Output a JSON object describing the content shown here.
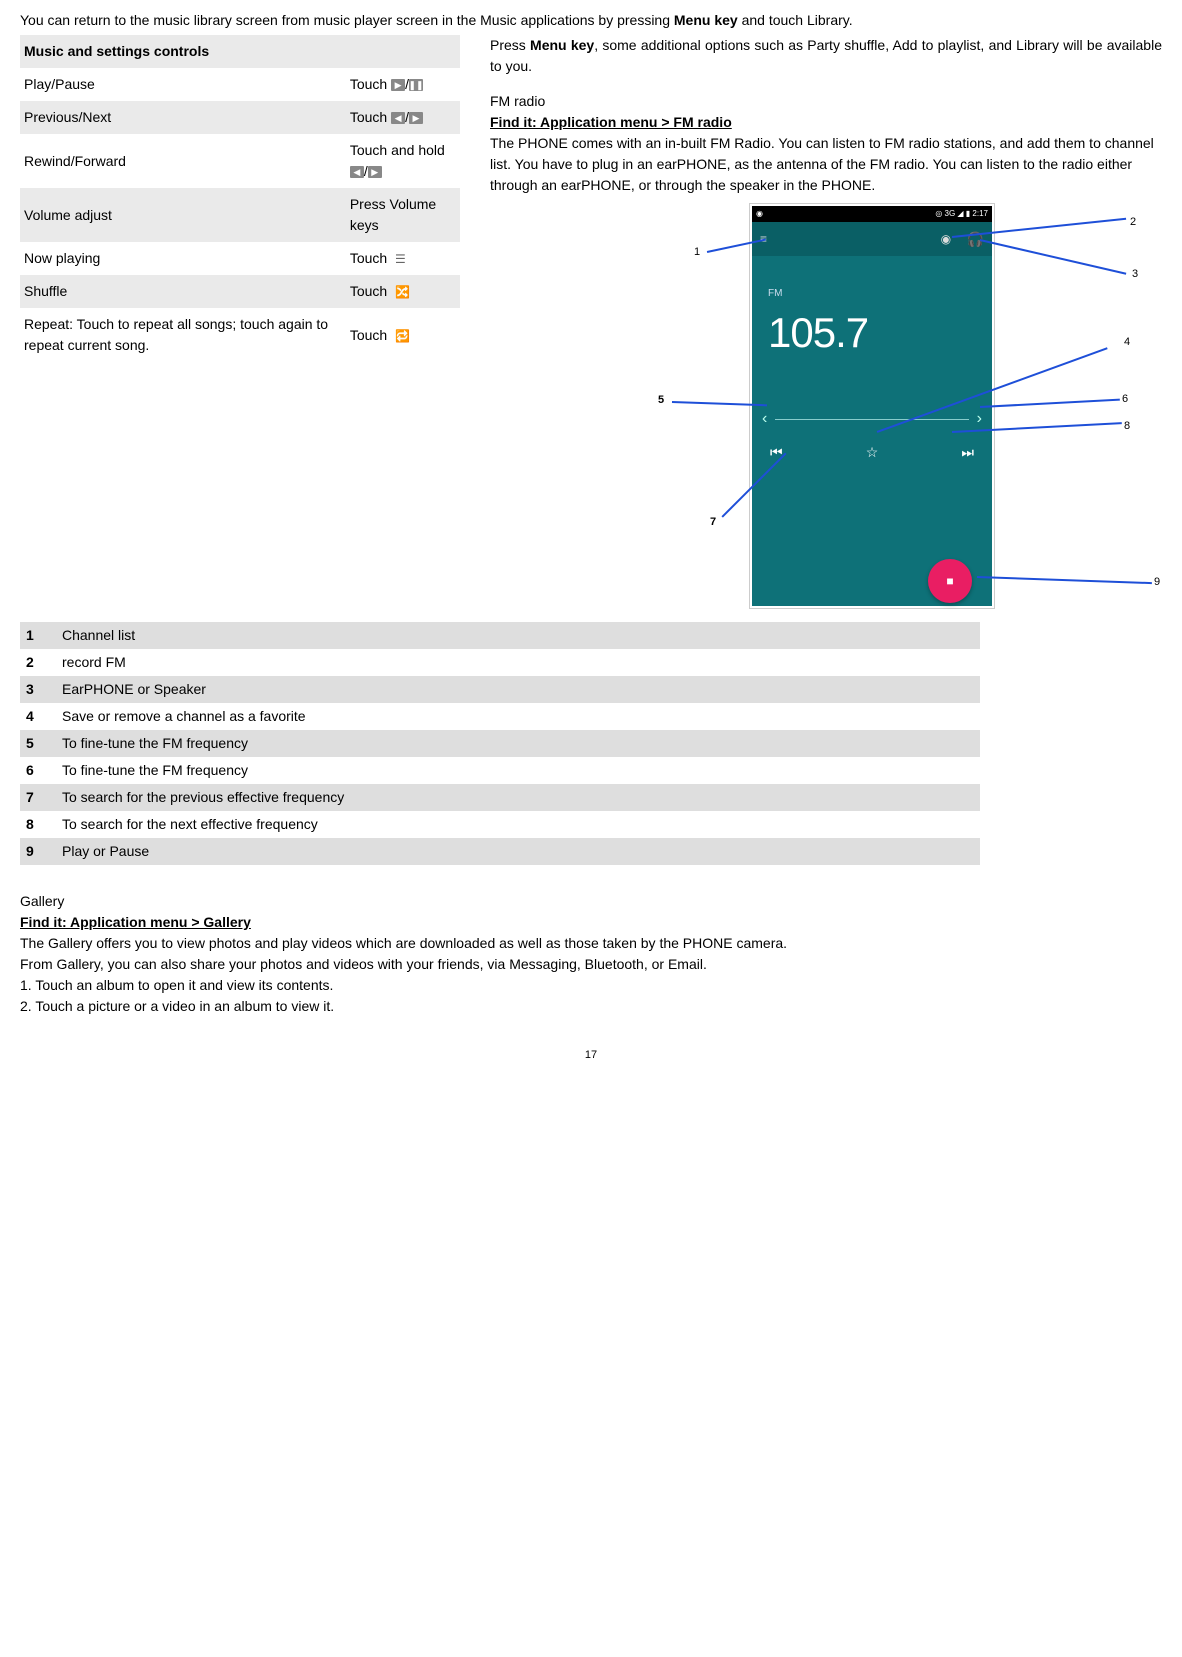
{
  "intro": {
    "pre": "You can return to the music library screen from music player screen in the Music applications by pressing ",
    "bold": "Menu key",
    "post": " and touch Library."
  },
  "music_table": {
    "header": "Music and settings controls",
    "rows": {
      "play_label": "Play/Pause",
      "play_action": "Touch",
      "prev_label": "Previous/Next",
      "prev_action": "Touch",
      "rewind_label": "Rewind/Forward",
      "rewind_action": "Touch and hold",
      "vol_label": "Volume adjust",
      "vol_action": "Press Volume keys",
      "now_label": "Now playing",
      "now_action": "Touch",
      "shuffle_label": "Shuffle",
      "shuffle_action": "Touch",
      "repeat_label": "Repeat: Touch to repeat all songs; touch again to repeat current song.",
      "repeat_action": "Touch"
    }
  },
  "right_text": {
    "p1_a": "Press ",
    "p1_bold": "Menu key",
    "p1_b": ", some additional options such as Party shuffle, Add to playlist, and Library will be available to you.",
    "fm_title": "FM radio",
    "fm_find": "Find it: Application menu > FM radio",
    "fm_body": "The PHONE comes with an in-built FM Radio. You can listen to FM radio stations, and add them to channel list. You have to plug in an earPHONE, as the antenna of the FM radio. You can listen to the radio either through an earPHONE, or through the speaker in the PHONE."
  },
  "phone": {
    "status_left": "◉",
    "status_right": "◎ 3G ◢ ▮ 2:17",
    "topbar_title": " ",
    "fm_label": "FM",
    "freq": "105.7",
    "tune_left": "‹",
    "tune_right": "›",
    "prev": "⏮",
    "star": "☆",
    "next": "⏭",
    "fab": "■"
  },
  "callouts": {
    "c1": "1",
    "c2": "2",
    "c3": "3",
    "c4": "4",
    "c5": "5",
    "c6": "6",
    "c7": "7",
    "c8": "8",
    "c9": "9"
  },
  "legend": {
    "n1": "1",
    "t1": "Channel list",
    "n2": "2",
    "t2": "record FM",
    "n3": "3",
    "t3": "EarPHONE or Speaker",
    "n4": "4",
    "t4": "Save or remove a channel as a favorite",
    "n5": "5",
    "t5": "To fine-tune the FM frequency",
    "n6": "6",
    "t6": "To fine-tune the FM frequency",
    "n7": "7",
    "t7": "To search for the previous effective frequency",
    "n8": "8",
    "t8": "To search for the next effective frequency",
    "n9": "9",
    "t9": "Play or Pause"
  },
  "gallery": {
    "title": "Gallery",
    "find": "Find it: Application menu > Gallery",
    "p1": "The Gallery offers you to view photos and play videos which are downloaded as well as those taken by the PHONE camera.",
    "p2": "From Gallery, you can also share your photos and videos with your friends, via Messaging, Bluetooth, or Email.",
    "s1": "1. Touch an album to open it and view its contents.",
    "s2": "2. Touch a picture or a video in an album to view it."
  },
  "page_number": "17"
}
